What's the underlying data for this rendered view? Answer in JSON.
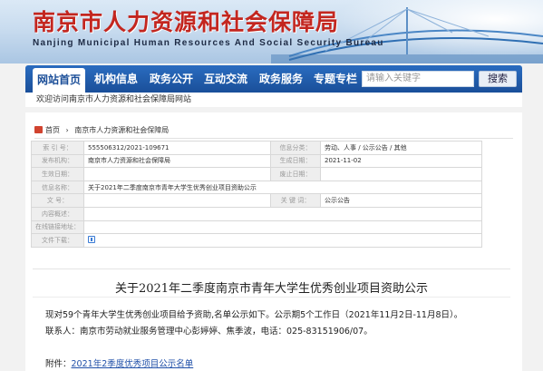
{
  "banner": {
    "title": "南京市人力资源和社会保障局",
    "subtitle": "Nanjing Municipal Human Resources And Social Security Bureau"
  },
  "nav": {
    "items": [
      "网站首页",
      "机构信息",
      "政务公开",
      "互动交流",
      "政务服务",
      "专题专栏"
    ],
    "search_placeholder": "请输入关键字",
    "search_button": "搜索"
  },
  "welcome": "欢迎访问南京市人力资源和社会保障局网站",
  "breadcrumb": {
    "home": "首页",
    "separator": "›",
    "current": "南京市人力资源和社会保障局"
  },
  "meta": {
    "index_label": "索  引  号：",
    "index_value": "555506312/2021-109671",
    "info_cat_label": "信息分类：",
    "info_cat_value": "劳动、人事 / 公示公告 / 其他",
    "publisher_label": "发布机构：",
    "publisher_value": "南京市人力资源和社会保障局",
    "gen_date_label": "生成日期：",
    "gen_date_value": "2021-11-02",
    "effective_label": "生效日期：",
    "effective_value": "",
    "abolish_label": "废止日期：",
    "abolish_value": "",
    "name_label": "信息名称：",
    "name_value": "关于2021年二季度南京市青年大学生优秀创业项目资助公示",
    "docno_label": "文      号：",
    "docno_value": "",
    "keywords_label": "关  键  词：",
    "keywords_value": "公示公告",
    "summary_label": "内容概述：",
    "summary_value": "",
    "address_label": "在线链接地址：",
    "address_value": "",
    "download_label": "文件下载："
  },
  "article": {
    "title": "关于2021年二季度南京市青年大学生优秀创业项目资助公示",
    "para1": "现对59个青年大学生优秀创业项目给予资助,名单公示如下。公示期5个工作日（2021年11月2日-11月8日）。",
    "para2": "联系人：南京市劳动就业服务管理中心彭婷婷、焦季波，电话：025-83151906/07。",
    "attach_label": "附件：",
    "attach_link": "2021年2季度优秀项目公示名单"
  }
}
